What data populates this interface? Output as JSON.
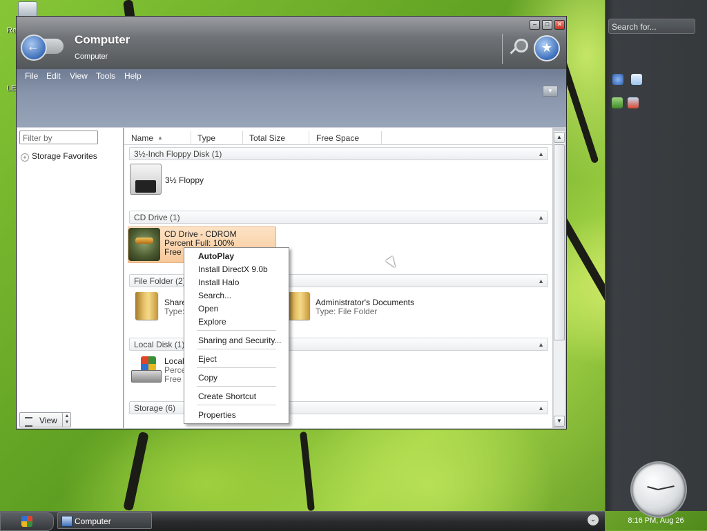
{
  "desktop": {
    "icons": [
      {
        "label": "Re",
        "name": "recycle-bin"
      },
      {
        "label": "LE",
        "name": "desktop-shortcut"
      }
    ]
  },
  "window": {
    "title": "Computer",
    "subtitle": "Computer",
    "menu": [
      "File",
      "Edit",
      "View",
      "Tools",
      "Help"
    ],
    "controls": {
      "minimize": "–",
      "maximize": "□",
      "close": "✕"
    }
  },
  "left_pane": {
    "filter_placeholder": "Filter by",
    "favorites_label": "Storage Favorites",
    "view_button": "View"
  },
  "columns": [
    "Name",
    "Type",
    "Total Size",
    "Free Space"
  ],
  "groups": [
    {
      "header": "3½-Inch Floppy Disk (1)",
      "items": [
        {
          "label": "3½ Floppy"
        }
      ]
    },
    {
      "header": "CD Drive (1)",
      "items": [
        {
          "label": "CD Drive - CDROM",
          "line2": "Percent Full: 100%",
          "line3": "Free S"
        }
      ]
    },
    {
      "header": "File Folder (2)",
      "items": [
        {
          "label": "Share",
          "line2": "Type:"
        },
        {
          "label": "Administrator's Documents",
          "line2": "Type: File Folder"
        }
      ]
    },
    {
      "header": "Local Disk (1)",
      "items": [
        {
          "label": "Local",
          "line2": "Perce",
          "line3": "Free S"
        }
      ]
    },
    {
      "header": "Storage (6)",
      "items": []
    }
  ],
  "context_menu": [
    "AutoPlay",
    "Install DirectX 9.0b",
    "Install Halo",
    "Search...",
    "Open",
    "Explore",
    "Sharing and Security...",
    "Eject",
    "Copy",
    "Create Shortcut",
    "Properties"
  ],
  "sidebar": {
    "search_placeholder": "Search for...",
    "clock_text": "8:16 PM, Aug 26"
  },
  "taskbar": {
    "task_label": "Computer"
  }
}
